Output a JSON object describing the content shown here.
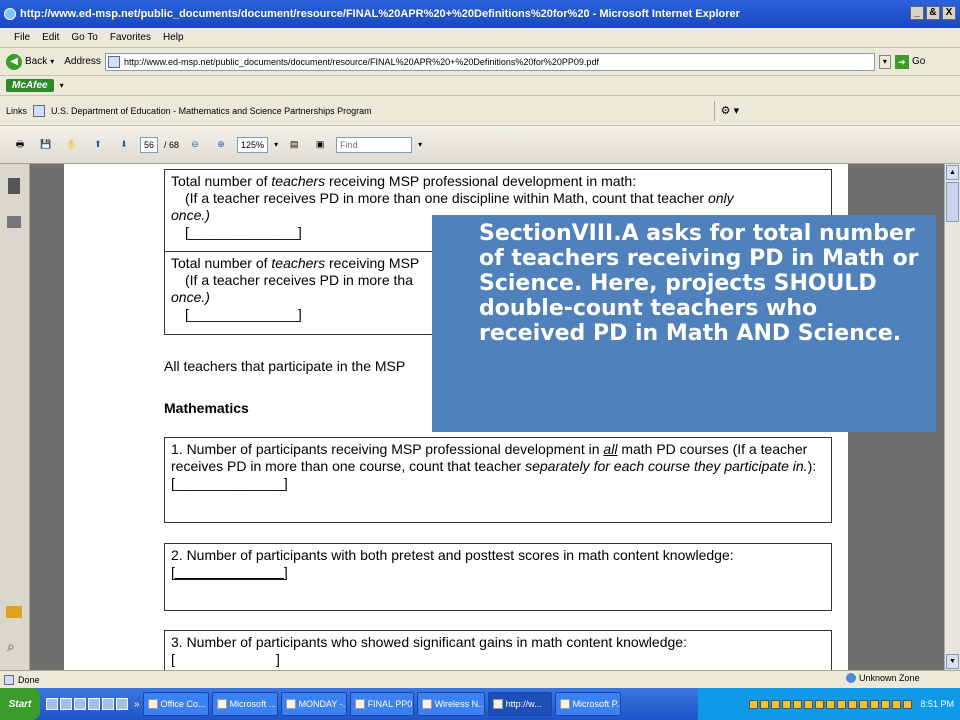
{
  "window": {
    "title": "http://www.ed-msp.net/public_documents/document/resource/FINAL%20APR%20+%20Definitions%20for%20 - Microsoft Internet Explorer",
    "buttons": [
      "_",
      "&",
      "X"
    ]
  },
  "menu": [
    "File",
    "Edit",
    "Go To",
    "Favorites",
    "Help"
  ],
  "nav": {
    "back_label": "Back",
    "address_label": "Address",
    "address_value": "http://www.ed-msp.net/public_documents/document/resource/FINAL%20APR%20+%20Definitions%20for%20PP09.pdf",
    "go_label": "Go"
  },
  "addon": {
    "mcafee_label": "McAfee"
  },
  "links": {
    "links_label": "Links",
    "item_label": "U.S. Department of Education - Mathematics and Science Partnerships Program"
  },
  "pdf": {
    "page_current": "56",
    "page_total": "/ 68",
    "zoom": "125%",
    "find_placeholder": "Find"
  },
  "document": {
    "box1": {
      "line1a": "Total number of ",
      "line1b": "teachers",
      "line1c": " receiving MSP professional development in math:",
      "line2a": "(If a teacher receives PD in more than one discipline within Math, count that teacher ",
      "line2b": "only",
      "line3": "once.)",
      "blank": "[______________]"
    },
    "box2": {
      "line1a": "Total number of ",
      "line1b": "teachers",
      "line1c": " receiving MSP",
      "line2": "(If a teacher receives PD in more tha",
      "line3": "once.)",
      "blank": "[______________]"
    },
    "para": "All teachers that participate in the MSP",
    "heading": "Mathematics",
    "item1": {
      "a": "1. Number of participants receiving MSP professional development in ",
      "b": "all",
      "c": " math PD courses (If a teacher receives PD in more than one course, count that teacher ",
      "d": "separately for each course they participate in.",
      "e": "):",
      "blank": "[______________]"
    },
    "item2": {
      "text": "2. Number of participants with both pretest and posttest scores in math content knowledge:",
      "blank": "[______________]"
    },
    "item3": {
      "text": "3. Number of participants who showed significant gains in math content knowledge:",
      "blank": "[                          ]"
    }
  },
  "callout": {
    "text": "SectionVIII.A asks for total number of teachers receiving PD in Math or Science.  Here, projects SHOULD double-count teachers who received PD in Math AND Science."
  },
  "status": {
    "left": "Done",
    "zone": "Unknown Zone"
  },
  "taskbar": {
    "start_label": "Start",
    "tasks": [
      "Office Co...",
      "Microsoft ...",
      "MONDAY -...",
      "FINAL PP0...",
      "Wireless N...",
      "http://w...",
      "Microsoft P..."
    ],
    "clock": "8:51 PM"
  }
}
